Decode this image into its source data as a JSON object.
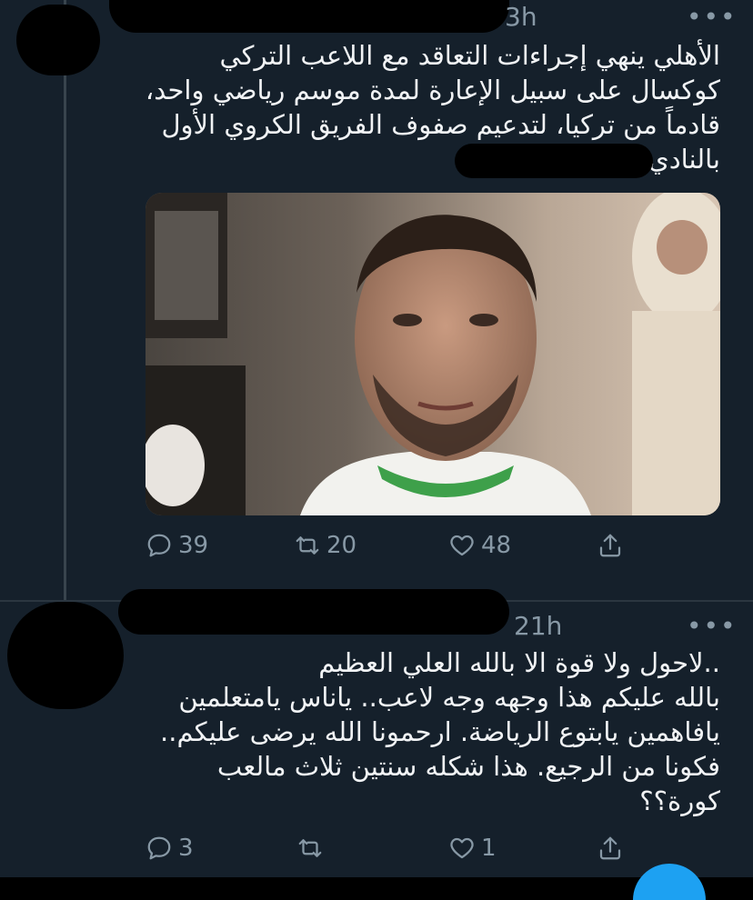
{
  "tweet1": {
    "time": "3h",
    "more": "•••",
    "text": "الأهلي ينهي إجراءات التعاقد مع اللاعب التركي\nكوكسال على سبيل الإعارة لمدة موسم رياضي واحد،\nقادماً من تركيا، لتدعيم صفوف الفريق الكروي الأول\nبالنادي",
    "replies": "39",
    "retweets": "20",
    "likes": "48"
  },
  "tweet2": {
    "time": "21h",
    "more": "•••",
    "text": "..لاحول ولا قوة الا بالله العلي العظيم\nبالله عليكم هذا وجهه وجه لاعب.. ياناس يامتعلمين\nيافاهمين يابتوع الرياضة. ارحمونا الله يرضى عليكم..\nفكونا من الرجيع. هذا شكله سنتين ثلاث مالعب\nكورة؟؟",
    "replies": "3",
    "retweets": "",
    "likes": "1"
  },
  "colors": {
    "background": "#15202b",
    "icon": "#8899a6",
    "accent": "#1da1f2"
  }
}
